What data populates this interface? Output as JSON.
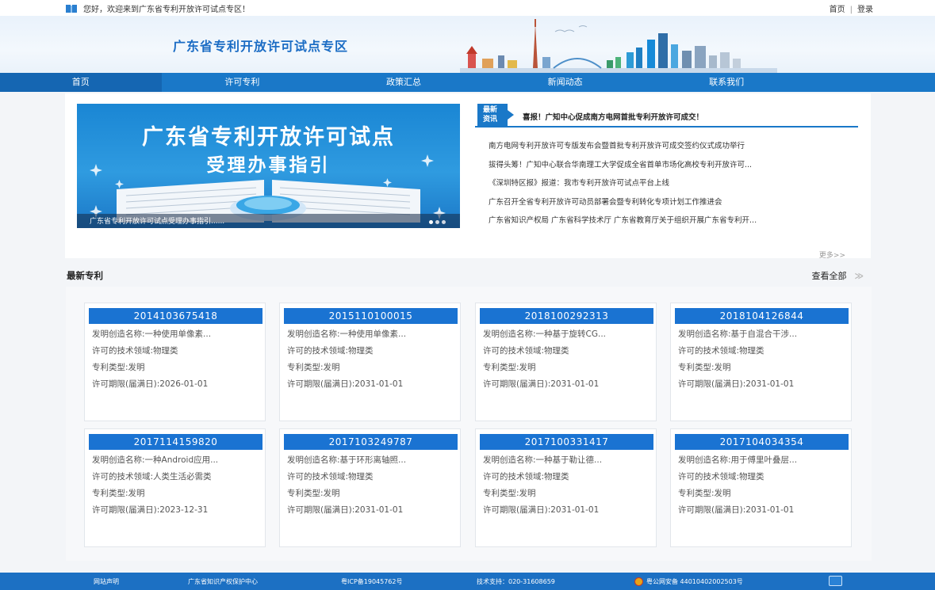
{
  "topbar": {
    "welcome": "您好，欢迎来到广东省专利开放许可试点专区！",
    "home_link": "首页",
    "separator": "|",
    "login_link": "登录"
  },
  "banner": {
    "title": "广东省专利开放许可试点专区"
  },
  "nav": {
    "items": [
      {
        "label": "首页",
        "active": true
      },
      {
        "label": "许可专利",
        "active": false
      },
      {
        "label": "政策汇总",
        "active": false
      },
      {
        "label": "新闻动态",
        "active": false
      },
      {
        "label": "联系我们",
        "active": false
      }
    ]
  },
  "slider": {
    "title_line1": "广东省专利开放许可试点",
    "title_line2": "受理办事指引",
    "caption": "广东省专利开放许可试点受理办事指引......"
  },
  "news": {
    "tag_line1": "最新",
    "tag_line2": "资讯",
    "headline": "喜报！广知中心促成南方电网首批专利开放许可成交！",
    "items": [
      "南方电网专利开放许可专版发布会暨首批专利开放许可成交签约仪式成功举行",
      "拔得头筹！广知中心联合华南理工大学促成全省首单市场化高校专利开放许可...",
      "《深圳特区报》报道：我市专利开放许可试点平台上线",
      "广东召开全省专利开放许可动员部署会暨专利转化专项计划工作推进会",
      "广东省知识产权局 广东省科学技术厅 广东省教育厅关于组织开展广东省专利开..."
    ],
    "more": "更多>>"
  },
  "section": {
    "title": "最新专利",
    "view_all": "查看全部",
    "arrow": "≫"
  },
  "patents": [
    {
      "number": "2014103675418",
      "name": "发明创造名称:一种使用单像素...",
      "field": "许可的技术领域:物理类",
      "type": "专利类型:发明",
      "term": "许可期限(届满日):2026-01-01"
    },
    {
      "number": "2015110100015",
      "name": "发明创造名称:一种使用单像素...",
      "field": "许可的技术领域:物理类",
      "type": "专利类型:发明",
      "term": "许可期限(届满日):2031-01-01"
    },
    {
      "number": "2018100292313",
      "name": "发明创造名称:一种基于旋转CG...",
      "field": "许可的技术领域:物理类",
      "type": "专利类型:发明",
      "term": "许可期限(届满日):2031-01-01"
    },
    {
      "number": "2018104126844",
      "name": "发明创造名称:基于自混合干涉...",
      "field": "许可的技术领域:物理类",
      "type": "专利类型:发明",
      "term": "许可期限(届满日):2031-01-01"
    },
    {
      "number": "2017114159820",
      "name": "发明创造名称:一种Android应用...",
      "field": "许可的技术领域:人类生活必需类",
      "type": "专利类型:发明",
      "term": "许可期限(届满日):2023-12-31"
    },
    {
      "number": "2017103249787",
      "name": "发明创造名称:基于环形离轴照...",
      "field": "许可的技术领域:物理类",
      "type": "专利类型:发明",
      "term": "许可期限(届满日):2031-01-01"
    },
    {
      "number": "2017100331417",
      "name": "发明创造名称:一种基于勒让德...",
      "field": "许可的技术领域:物理类",
      "type": "专利类型:发明",
      "term": "许可期限(届满日):2031-01-01"
    },
    {
      "number": "2017104034354",
      "name": "发明创造名称:用于傅里叶叠层...",
      "field": "许可的技术领域:物理类",
      "type": "专利类型:发明",
      "term": "许可期限(届满日):2031-01-01"
    }
  ],
  "footer": {
    "statement": "网站声明",
    "org": "广东省知识产权保护中心",
    "icp": "粤ICP备19045762号",
    "support": "技术支持：020-31608659",
    "police": "粤公网安备 44010402002503号"
  },
  "colors": {
    "primary": "#1a78c8",
    "card_header": "#1a73d2",
    "footer": "#1c70c3"
  }
}
